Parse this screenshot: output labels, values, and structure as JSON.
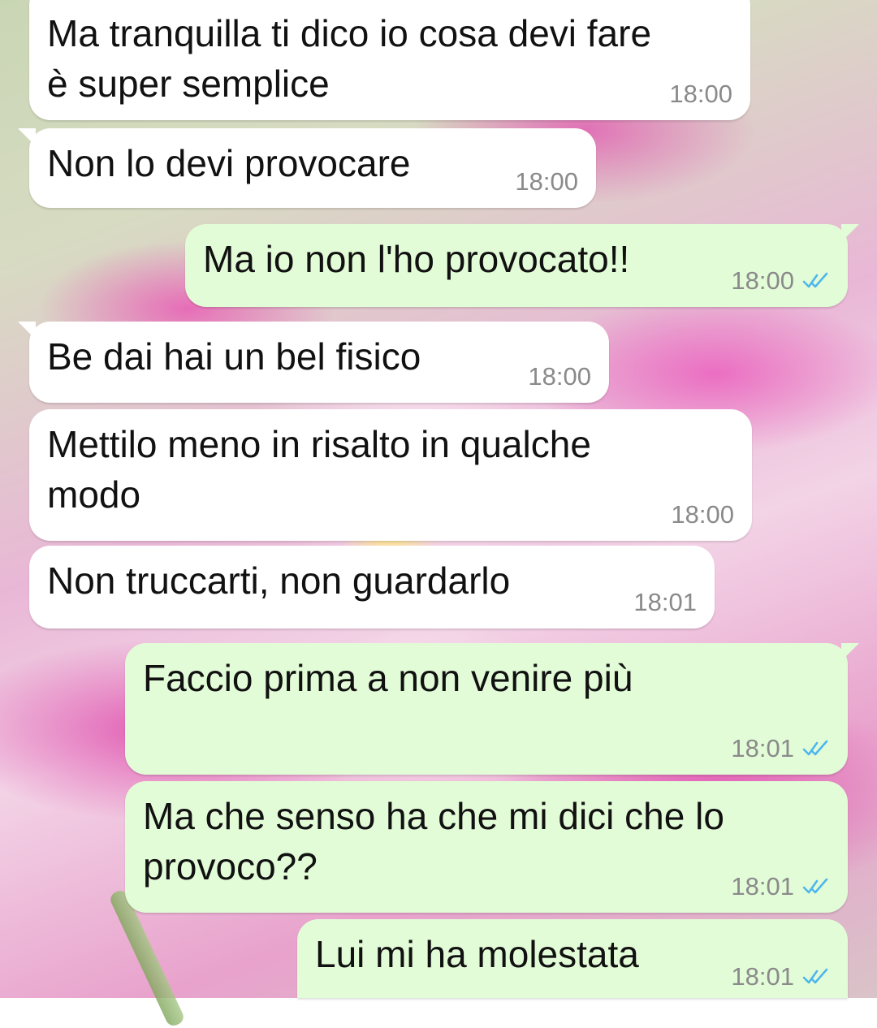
{
  "colors": {
    "incoming_bubble": "#ffffff",
    "outgoing_bubble": "#e3fcd8",
    "read_ticks": "#4fb6ec",
    "timestamp": "#8a8a8a"
  },
  "messages": [
    {
      "direction": "incoming",
      "text": "Ma tranquilla ti dico io cosa devi fare\nè super semplice",
      "time": "18:00"
    },
    {
      "direction": "incoming",
      "text": "Non lo devi provocare",
      "time": "18:00"
    },
    {
      "direction": "outgoing",
      "text": "Ma io non l'ho provocato!!",
      "time": "18:00",
      "status_icon": "double-check-read-icon"
    },
    {
      "direction": "incoming",
      "text": "Be dai hai un bel fisico",
      "time": "18:00"
    },
    {
      "direction": "incoming",
      "text": "Mettilo meno in risalto in qualche\nmodo",
      "time": "18:00"
    },
    {
      "direction": "incoming",
      "text": "Non truccarti, non guardarlo",
      "time": "18:01"
    },
    {
      "direction": "outgoing",
      "text": "Faccio prima a non venire più",
      "time": "18:01",
      "status_icon": "double-check-read-icon"
    },
    {
      "direction": "outgoing",
      "text": "Ma che senso ha che mi dici che lo\nprovoco??",
      "time": "18:01",
      "status_icon": "double-check-read-icon"
    },
    {
      "direction": "outgoing",
      "text": "Lui mi ha molestata",
      "time": "18:01",
      "status_icon": "double-check-read-icon"
    }
  ]
}
